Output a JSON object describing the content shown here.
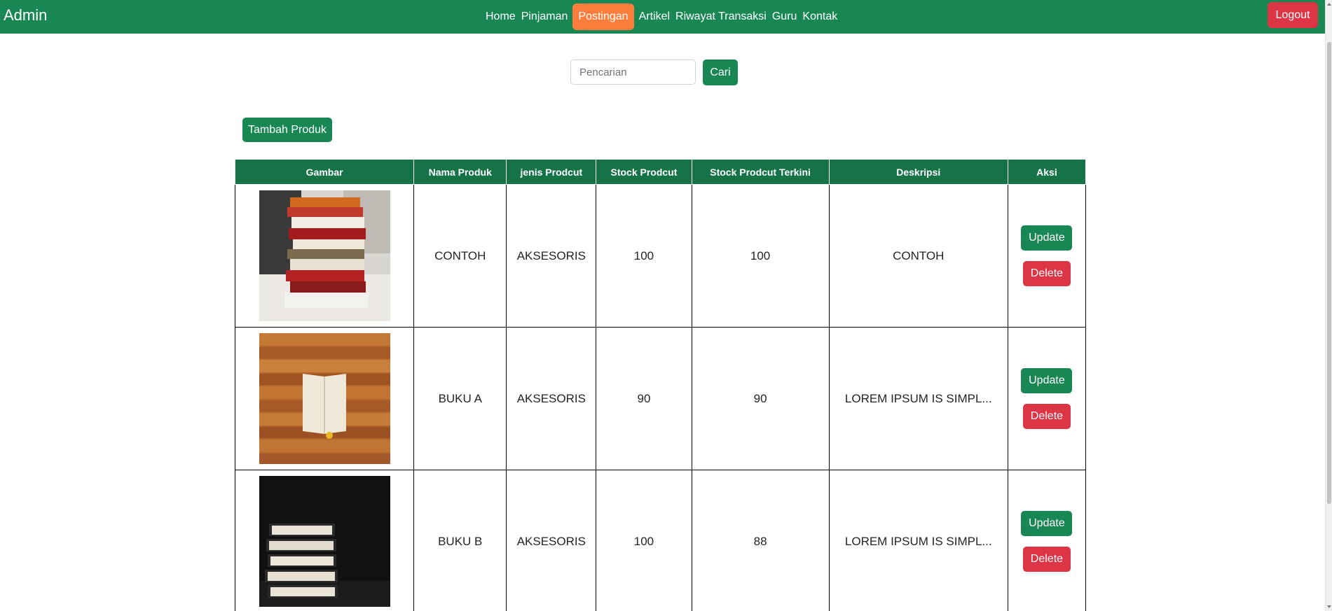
{
  "navbar": {
    "brand": "Admin",
    "links": [
      {
        "label": "Home",
        "active": false
      },
      {
        "label": "Pinjaman",
        "active": false
      },
      {
        "label": "Postingan",
        "active": true
      },
      {
        "label": "Artikel",
        "active": false
      },
      {
        "label": "Riwayat Transaksi",
        "active": false
      },
      {
        "label": "Guru",
        "active": false
      },
      {
        "label": "Kontak",
        "active": false
      }
    ],
    "logout_label": "Logout"
  },
  "search": {
    "placeholder": "Pencarian",
    "value": "",
    "button_label": "Cari"
  },
  "add_button_label": "Tambah Produk",
  "table": {
    "headers": [
      "Gambar",
      "Nama Produk",
      "jenis Prodcut",
      "Stock Prodcut",
      "Stock Prodcut Terkini",
      "Deskripsi",
      "Aksi"
    ],
    "rows": [
      {
        "image": "stacked-books-photo",
        "nama": "CONTOH",
        "jenis": "AKSESORIS",
        "stock": "100",
        "stock_terkini": "100",
        "deskripsi": "CONTOH",
        "update_label": "Update",
        "delete_label": "Delete"
      },
      {
        "image": "open-book-on-wood-photo",
        "nama": "BUKU A",
        "jenis": "AKSESORIS",
        "stock": "90",
        "stock_terkini": "90",
        "deskripsi": "LOREM IPSUM IS SIMPL...",
        "update_label": "Update",
        "delete_label": "Delete"
      },
      {
        "image": "book-stack-dark-photo",
        "nama": "BUKU B",
        "jenis": "AKSESORIS",
        "stock": "100",
        "stock_terkini": "88",
        "deskripsi": "LOREM IPSUM IS SIMPL...",
        "update_label": "Update",
        "delete_label": "Delete"
      }
    ]
  },
  "colors": {
    "primary_green": "#198754",
    "header_green": "#157347",
    "active_orange": "#fd7e3c",
    "danger_red": "#dc3545"
  }
}
